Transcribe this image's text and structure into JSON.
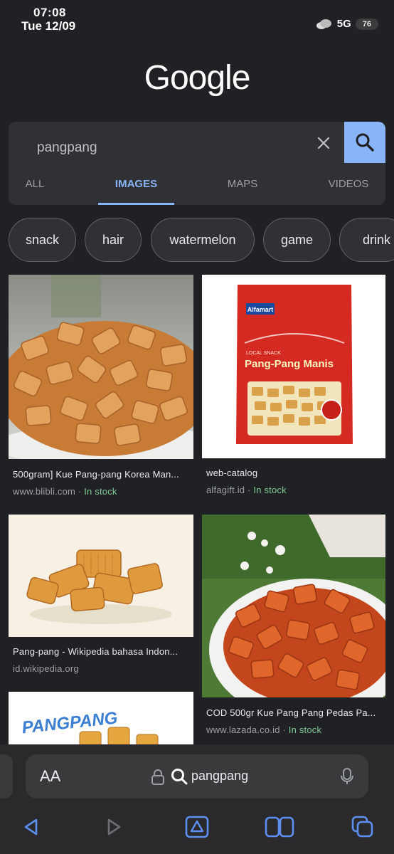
{
  "status_bar": {
    "time": "07:08",
    "date": "Tue 12/09",
    "network": "5G",
    "battery": "76"
  },
  "logo": "Google",
  "search": {
    "query": "pangpang",
    "placeholder": ""
  },
  "tabs": [
    {
      "label": "ALL"
    },
    {
      "label": "IMAGES"
    },
    {
      "label": "MAPS"
    },
    {
      "label": "VIDEOS"
    }
  ],
  "active_tab": "IMAGES",
  "chips": [
    "snack",
    "hair",
    "watermelon",
    "game",
    "drink"
  ],
  "results": [
    {
      "title": "500gram] Kue Pang-pang Korea Man...",
      "source": "www.blibli.com",
      "stock": "In stock",
      "sep": " · "
    },
    {
      "title": "web-catalog",
      "source": "alfagift.id",
      "stock": "In stock",
      "sep": " · ",
      "image_text": {
        "brand": "Alfamart",
        "tag": "LOCAL SNACK",
        "name": "Pang-Pang Manis"
      }
    },
    {
      "title": "Pang-pang - Wikipedia bahasa Indon...",
      "source": "id.wikipedia.org",
      "stock": "",
      "sep": ""
    },
    {
      "title": "COD 500gr Kue Pang Pang Pedas Pa...",
      "source": "www.lazada.co.id",
      "stock": "In stock",
      "sep": " · "
    },
    {
      "title": "",
      "source": "",
      "stock": "",
      "sep": "",
      "image_text": {
        "brand": "PANGPANG"
      }
    }
  ],
  "browser": {
    "text_size_label": "AA",
    "address": "pangpang"
  },
  "colors": {
    "accent": "#8ab4f8",
    "in_stock": "#81c995",
    "background": "#202124",
    "surface": "#303134"
  }
}
